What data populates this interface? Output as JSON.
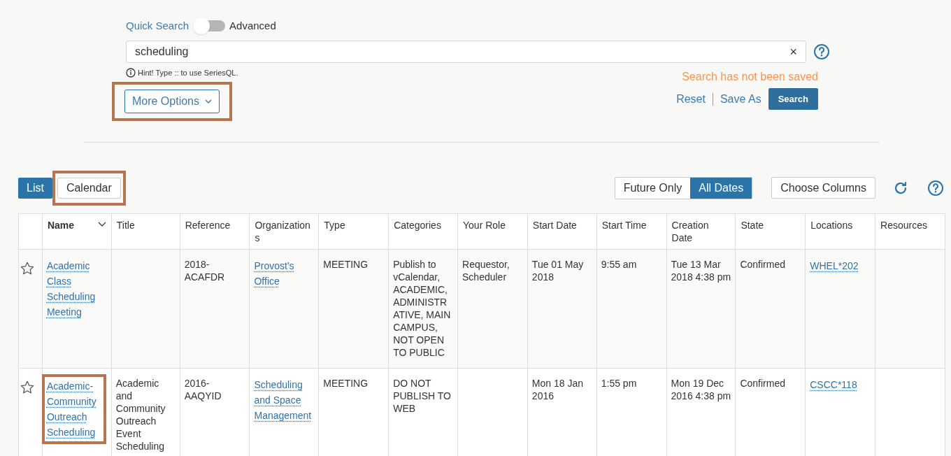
{
  "search": {
    "mode_left": "Quick Search",
    "mode_toggle": {
      "on": false
    },
    "mode_right": "Advanced",
    "value": "scheduling",
    "clear": "×",
    "hint": "Hint! Type :: to use SeriesQL.",
    "more_options": {
      "label": "More Options",
      "highlighted": true
    },
    "status": "Search has not been saved",
    "reset": "Reset",
    "save_as": "Save As",
    "search_button": "Search"
  },
  "view_tabs": [
    {
      "label": "List",
      "selected": true,
      "highlighted": false
    },
    {
      "label": "Calendar",
      "selected": false,
      "highlighted": true
    }
  ],
  "date_filter": [
    {
      "label": "Future Only",
      "selected": false
    },
    {
      "label": "All Dates",
      "selected": true
    }
  ],
  "choose_columns": "Choose Columns",
  "table": {
    "columns": [
      "Name",
      "Title",
      "Reference",
      "Organizations",
      "Type",
      "Categories",
      "Your Role",
      "Start Date",
      "Start Time",
      "Creation Date",
      "State",
      "Locations",
      "Resources"
    ],
    "rows": [
      {
        "starred": false,
        "cells": [
          {
            "kind": "link",
            "text": "Academic Class Scheduling Meeting",
            "highlighted": false
          },
          {
            "kind": "empty"
          },
          {
            "kind": "text",
            "text": "2018-ACAFDR"
          },
          {
            "kind": "link",
            "text": "Provost's Office"
          },
          {
            "kind": "text",
            "text": "MEETING"
          },
          {
            "kind": "text",
            "text": "Publish to vCalendar, ACADEMIC, ADMINISTRATIVE, MAIN CAMPUS, NOT OPEN TO PUBLIC"
          },
          {
            "kind": "text",
            "text": "Requestor, Scheduler"
          },
          {
            "kind": "text",
            "text": "Tue 01 May 2018"
          },
          {
            "kind": "text",
            "text": "9:55 am"
          },
          {
            "kind": "text",
            "text": "Tue 13 Mar 2018 4:38 pm"
          },
          {
            "kind": "text",
            "text": "Confirmed"
          },
          {
            "kind": "link",
            "text": "WHEL*202"
          },
          {
            "kind": "empty"
          }
        ]
      },
      {
        "starred": false,
        "cells": [
          {
            "kind": "link",
            "text": "Academic-Community Outreach Scheduling",
            "highlighted": true
          },
          {
            "kind": "text",
            "text": "Academic and Community Outreach Event Scheduling"
          },
          {
            "kind": "text",
            "text": "2016-AAQYID"
          },
          {
            "kind": "link",
            "text": "Scheduling and Space Management"
          },
          {
            "kind": "text",
            "text": "MEETING"
          },
          {
            "kind": "text",
            "text": "DO NOT PUBLISH TO WEB"
          },
          {
            "kind": "empty"
          },
          {
            "kind": "text",
            "text": "Mon 18 Jan 2016"
          },
          {
            "kind": "text",
            "text": "1:55 pm"
          },
          {
            "kind": "text",
            "text": "Mon 19 Dec 2016 4:38 pm"
          },
          {
            "kind": "text",
            "text": "Confirmed"
          },
          {
            "kind": "link",
            "text": "CSCC*118"
          },
          {
            "kind": "empty"
          }
        ]
      }
    ]
  }
}
